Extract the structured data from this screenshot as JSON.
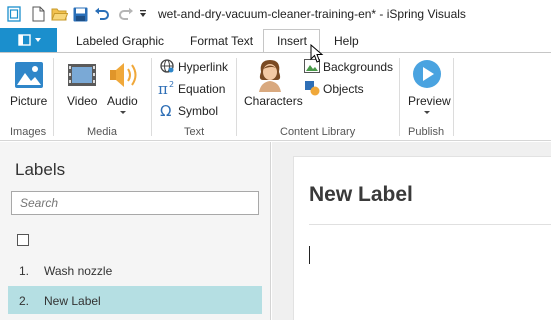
{
  "window": {
    "title": "wet-and-dry-vacuum-cleaner-training-en* - iSpring Visuals"
  },
  "ribbon": {
    "tabs": [
      {
        "label": "Labeled Graphic"
      },
      {
        "label": "Format Text"
      },
      {
        "label": "Insert",
        "active": true
      },
      {
        "label": "Help"
      }
    ],
    "groups": {
      "images": {
        "label": "Images",
        "picture": "Picture"
      },
      "media": {
        "label": "Media",
        "video": "Video",
        "audio": "Audio"
      },
      "text": {
        "label": "Text",
        "hyperlink": "Hyperlink",
        "equation": "Equation",
        "symbol": "Symbol"
      },
      "content_library": {
        "label": "Content Library",
        "characters": "Characters",
        "backgrounds": "Backgrounds",
        "objects": "Objects"
      },
      "publish": {
        "label": "Publish",
        "preview": "Preview"
      }
    }
  },
  "labels_panel": {
    "title": "Labels",
    "search_placeholder": "Search",
    "items": [
      {
        "num": "1.",
        "text": "Wash nozzle",
        "selected": false
      },
      {
        "num": "2.",
        "text": "New Label",
        "selected": true
      }
    ]
  },
  "editor": {
    "label_title": "New Label"
  },
  "colors": {
    "accent": "#1b8fcd",
    "selected_row": "#b5dfe3"
  }
}
